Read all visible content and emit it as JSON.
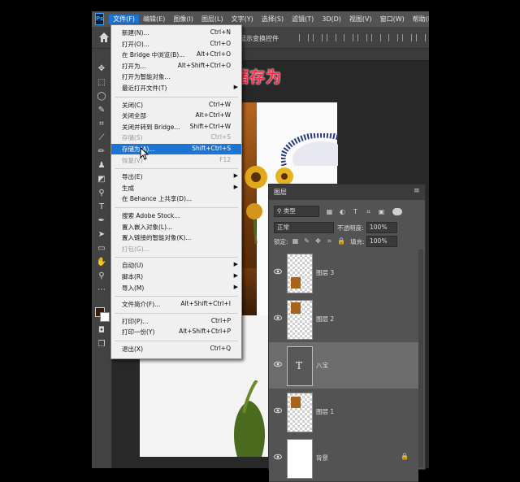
{
  "app": {
    "logo": "Ps",
    "menubar": [
      "文件(F)",
      "编辑(E)",
      "图像(I)",
      "图层(L)",
      "文字(Y)",
      "选择(S)",
      "滤镜(T)",
      "3D(D)",
      "视图(V)",
      "窗口(W)",
      "帮助(H)"
    ],
    "active_menu": "文件(F)"
  },
  "options_bar": {
    "show_transform_label": "显示变换控件"
  },
  "annotation": "储存为",
  "file_menu": [
    {
      "label": "新建(N)...",
      "shortcut": "Ctrl+N"
    },
    {
      "label": "打开(O)...",
      "shortcut": "Ctrl+O"
    },
    {
      "label": "在 Bridge 中浏览(B)...",
      "shortcut": "Alt+Ctrl+O"
    },
    {
      "label": "打开为...",
      "shortcut": "Alt+Shift+Ctrl+O"
    },
    {
      "label": "打开为智能对象...",
      "shortcut": ""
    },
    {
      "label": "最近打开文件(T)",
      "shortcut": "",
      "submenu": true
    },
    {
      "separator": true
    },
    {
      "label": "关闭(C)",
      "shortcut": "Ctrl+W"
    },
    {
      "label": "关闭全部",
      "shortcut": "Alt+Ctrl+W"
    },
    {
      "label": "关闭并转到 Bridge...",
      "shortcut": "Shift+Ctrl+W"
    },
    {
      "label": "存储(S)",
      "shortcut": "Ctrl+S",
      "disabled": true
    },
    {
      "label": "存储为(A)...",
      "shortcut": "Shift+Ctrl+S",
      "highlighted": true
    },
    {
      "label": "恢复(V)",
      "shortcut": "F12",
      "disabled": true
    },
    {
      "separator": true
    },
    {
      "label": "导出(E)",
      "shortcut": "",
      "submenu": true
    },
    {
      "label": "生成",
      "shortcut": "",
      "submenu": true
    },
    {
      "label": "在 Behance 上共享(D)...",
      "shortcut": ""
    },
    {
      "separator": true
    },
    {
      "label": "搜索 Adobe Stock...",
      "shortcut": ""
    },
    {
      "label": "置入嵌入对象(L)...",
      "shortcut": ""
    },
    {
      "label": "置入链接的智能对象(K)...",
      "shortcut": ""
    },
    {
      "label": "打包(G)...",
      "shortcut": "",
      "disabled": true
    },
    {
      "separator": true
    },
    {
      "label": "自动(U)",
      "shortcut": "",
      "submenu": true
    },
    {
      "label": "脚本(R)",
      "shortcut": "",
      "submenu": true
    },
    {
      "label": "导入(M)",
      "shortcut": "",
      "submenu": true
    },
    {
      "separator": true
    },
    {
      "label": "文件简介(F)...",
      "shortcut": "Alt+Shift+Ctrl+I"
    },
    {
      "separator": true
    },
    {
      "label": "打印(P)...",
      "shortcut": "Ctrl+P"
    },
    {
      "label": "打印一份(Y)",
      "shortcut": "Alt+Shift+Ctrl+P"
    },
    {
      "separator": true
    },
    {
      "label": "退出(X)",
      "shortcut": "Ctrl+Q"
    }
  ],
  "layers_panel": {
    "title": "图层",
    "filter_kind": "类型",
    "blend_mode": "正常",
    "opacity_label": "不透明度:",
    "opacity_value": "100%",
    "lock_label": "锁定:",
    "fill_label": "填充:",
    "fill_value": "100%",
    "layers": [
      {
        "name": "图层 3",
        "type": "image",
        "selected": false
      },
      {
        "name": "图层 2",
        "type": "image",
        "selected": false
      },
      {
        "name": "八宝",
        "type": "text",
        "selected": true
      },
      {
        "name": "图层 1",
        "type": "image",
        "selected": false
      },
      {
        "name": "背景",
        "type": "background",
        "selected": false
      }
    ]
  },
  "colors": {
    "accent": "#1c75d4",
    "annotation": "#ff2a4a",
    "panel": "#535353"
  }
}
